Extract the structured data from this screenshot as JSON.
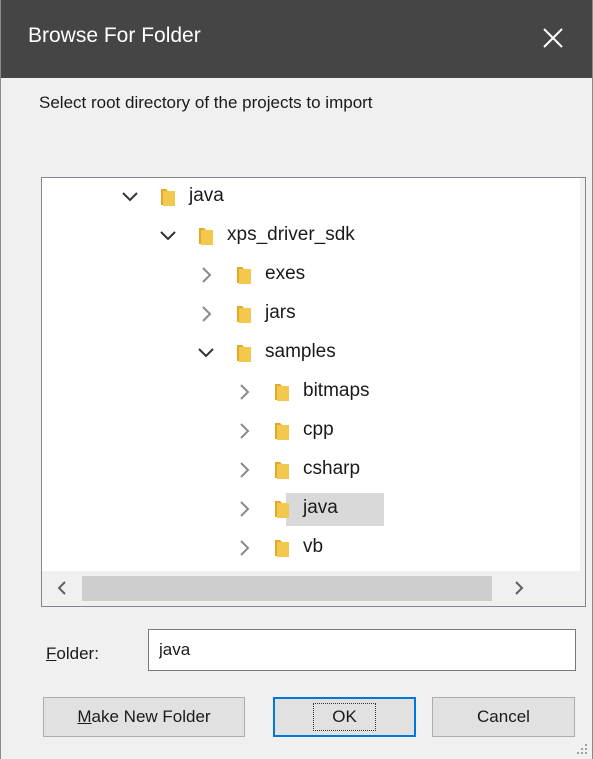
{
  "window": {
    "title": "Browse For Folder",
    "close_icon": "close-icon"
  },
  "prompt": "Select root directory of the projects to import",
  "tree": {
    "nodes": [
      {
        "label": "java",
        "expanded": true,
        "level": 0
      },
      {
        "label": "xps_driver_sdk",
        "expanded": true,
        "level": 1
      },
      {
        "label": "exes",
        "expanded": false,
        "level": 2
      },
      {
        "label": "jars",
        "expanded": false,
        "level": 2
      },
      {
        "label": "samples",
        "expanded": true,
        "level": 2
      },
      {
        "label": "bitmaps",
        "expanded": false,
        "level": 3
      },
      {
        "label": "cpp",
        "expanded": false,
        "level": 3
      },
      {
        "label": "csharp",
        "expanded": false,
        "level": 3
      },
      {
        "label": "java",
        "expanded": false,
        "level": 3,
        "selected": true
      },
      {
        "label": "vb",
        "expanded": false,
        "level": 3
      }
    ]
  },
  "folder_field": {
    "label_prefix": "F",
    "label_rest": "older:",
    "value": "java"
  },
  "buttons": {
    "make_new_folder_prefix": "M",
    "make_new_folder_rest": "ake New Folder",
    "ok": "OK",
    "cancel": "Cancel"
  },
  "colors": {
    "titlebar": "#454545",
    "folder_yellow": "#f4c84c",
    "selection": "#d9d9d9",
    "ok_border": "#0078d7"
  }
}
